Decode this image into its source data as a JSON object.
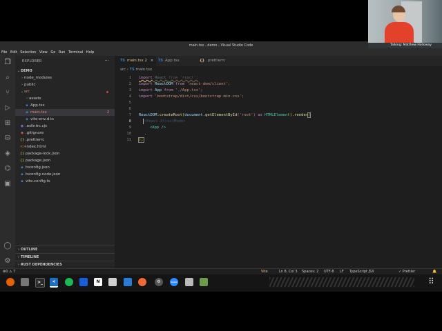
{
  "window": {
    "title": "main.tsx - demo - Visual Studio Code"
  },
  "menu": [
    "File",
    "Edit",
    "Selection",
    "View",
    "Go",
    "Run",
    "Terminal",
    "Help"
  ],
  "sidebar": {
    "header": "EXPLORER",
    "more": "···",
    "root": "DEMO",
    "items": [
      {
        "label": "node_modules",
        "icon": "chevron-right"
      },
      {
        "label": "public",
        "icon": "chevron-right"
      },
      {
        "label": "src",
        "icon": "chevron-down"
      },
      {
        "label": "assets",
        "icon": "chevron-right"
      },
      {
        "label": "App.tsx",
        "icon": "ts"
      },
      {
        "label": "main.tsx",
        "icon": "ts",
        "badge": "2"
      },
      {
        "label": "vite-env.d.ts",
        "icon": "ts"
      },
      {
        "label": ".eslintrc.cjs",
        "icon": "eslint"
      },
      {
        "label": ".gitignore",
        "icon": "git"
      },
      {
        "label": ".prettierrc",
        "icon": "braces"
      },
      {
        "label": "index.html",
        "icon": "html"
      },
      {
        "label": "package-lock.json",
        "icon": "json"
      },
      {
        "label": "package.json",
        "icon": "json"
      },
      {
        "label": "tsconfig.json",
        "icon": "tsconfig"
      },
      {
        "label": "tsconfig.node.json",
        "icon": "tsconfig"
      },
      {
        "label": "vite.config.ts",
        "icon": "ts"
      }
    ],
    "panels": [
      "OUTLINE",
      "TIMELINE",
      "RUST DEPENDENCIES"
    ]
  },
  "tabs": [
    {
      "label": "main.tsx",
      "badge": "2",
      "prefix": "TS"
    },
    {
      "label": "App.tsx",
      "prefix": "TS"
    },
    {
      "label": ".prettierrc",
      "prefix": "{}"
    }
  ],
  "breadcrumb": {
    "folder": "src",
    "sep": "›",
    "prefix": "TS",
    "file": "main.tsx"
  },
  "code": {
    "line_numbers": [
      "1",
      "2",
      "3",
      "4",
      "5",
      "6",
      "7",
      "8",
      "9",
      "10",
      "11"
    ],
    "line1": [
      "import",
      " React ",
      "from",
      " 'react';"
    ],
    "line2": [
      "import",
      " ReactDOM ",
      "from",
      " 'react-dom/client';"
    ],
    "line3": [
      "import",
      " App ",
      "from",
      " './App.tsx';"
    ],
    "line4": [
      "import",
      " 'bootstrap/dist/css/bootstrap.min.css';"
    ],
    "line7": [
      "ReactDOM",
      ".",
      "createRoot",
      "(",
      "document",
      ".",
      "getElementById",
      "(",
      "'root'",
      ") ",
      "as",
      " ",
      "HTMLElement",
      ").",
      "render",
      "("
    ],
    "line8": "<React.StrictMode>",
    "line9": "<App />",
    "line10": ",",
    "line11": ");"
  },
  "status": {
    "left": "⊗0 ⚠ 7",
    "vite": "Vite",
    "cursor": "Ln 8, Col 3",
    "spaces": "Spaces: 2",
    "encoding": "UTF-8",
    "eol": "LF",
    "language": "TypeScript JSX",
    "prettier": "✓ Prettier"
  },
  "video": {
    "label": "Talking: Matthew Holloway"
  },
  "taskbar": [
    "firefox-icon",
    "files-icon",
    "terminal-icon",
    "vscode-icon",
    "spotify-icon",
    "bitwarden-icon",
    "notion-icon",
    "docs-icon",
    "figma-icon",
    "postman-icon",
    "settings-icon",
    "zoom-icon",
    "files2-icon",
    "archive-icon"
  ]
}
